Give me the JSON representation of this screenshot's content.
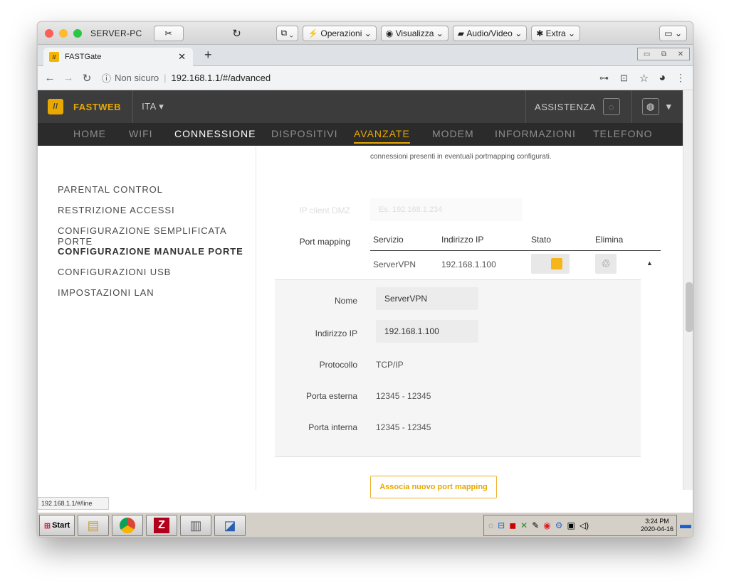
{
  "mac": {
    "title": "SERVER-PC",
    "ops": "Operazioni",
    "view": "Visualizza",
    "av": "Audio/Video",
    "extra": "Extra"
  },
  "browser": {
    "tab_title": "FASTGate",
    "url_warn": "Non sicuro",
    "url": "192.168.1.1/#/advanced"
  },
  "fastweb": {
    "brand": "FASTWEB",
    "lang": "ITA",
    "assist": "ASSISTENZA"
  },
  "menu": [
    {
      "label": "HOME"
    },
    {
      "label": "WIFI"
    },
    {
      "label": "CONNESSIONE"
    },
    {
      "label": "DISPOSITIVI"
    },
    {
      "label": "AVANZATE"
    },
    {
      "label": "MODEM"
    },
    {
      "label": "INFORMAZIONI"
    },
    {
      "label": "TELEFONO"
    }
  ],
  "sidebar": [
    {
      "label": "PARENTAL CONTROL"
    },
    {
      "label": "RESTRIZIONE ACCESSI"
    },
    {
      "label": "CONFIGURAZIONE SEMPLIFICATA PORTE"
    },
    {
      "label": "CONFIGURAZIONE MANUALE PORTE"
    },
    {
      "label": "CONFIGURAZIONI USB"
    },
    {
      "label": "IMPOSTAZIONI LAN"
    }
  ],
  "main": {
    "note": "connessioni presenti in eventuali portmapping configurati.",
    "dmz_label": "IP client DMZ",
    "dmz_placeholder": "Es. 192.168.1.234",
    "pm_label": "Port mapping",
    "cols": {
      "service": "Servizio",
      "ip": "Indirizzo IP",
      "state": "Stato",
      "delete": "Elimina"
    },
    "row": {
      "service": "ServerVPN",
      "ip": "192.168.1.100"
    },
    "detail": {
      "name_label": "Nome",
      "name_value": "ServerVPN",
      "ip_label": "Indirizzo IP",
      "ip_value": "192.168.1.100",
      "proto_label": "Protocollo",
      "proto_value": "TCP/IP",
      "ext_label": "Porta esterna",
      "ext_value": "12345 - 12345",
      "int_label": "Porta interna",
      "int_value": "12345 - 12345"
    },
    "add_button": "Associa nuovo port mapping"
  },
  "statusbar": "192.168.1.1/#/line",
  "taskbar": {
    "start": "Start",
    "time": "3:24 PM",
    "date": "2020-04-16"
  },
  "colors": {
    "accent": "#e8a800",
    "dark": "#2b2b2b"
  }
}
